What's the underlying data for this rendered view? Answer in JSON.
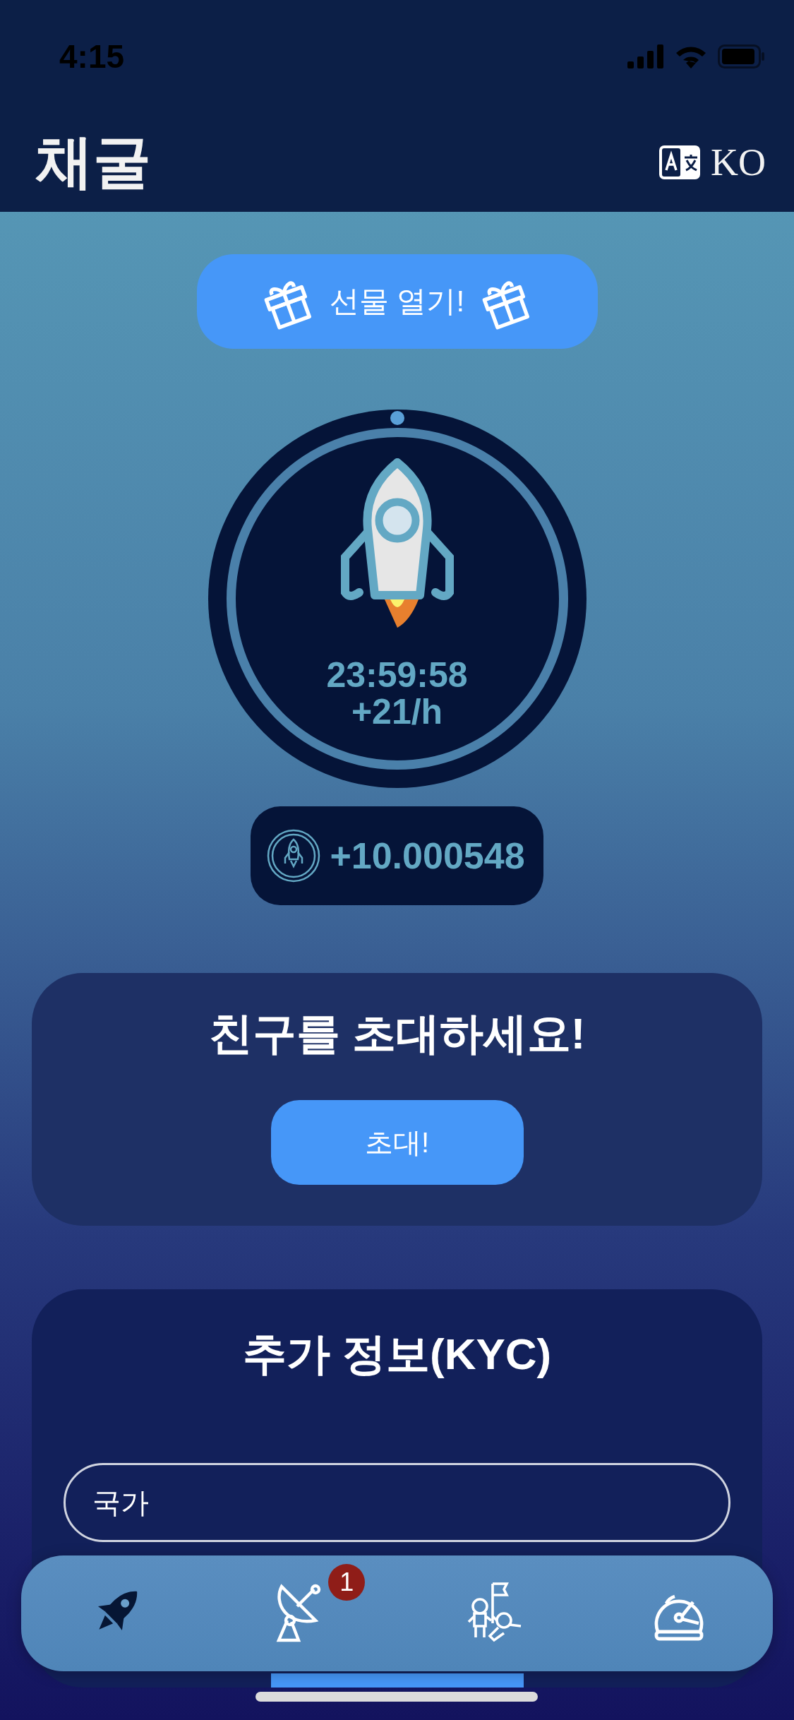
{
  "status_bar": {
    "time": "4:15"
  },
  "header": {
    "title": "채굴",
    "language": "KO"
  },
  "gift_button": {
    "label": "선물 열기!"
  },
  "miner": {
    "timer": "23:59:58",
    "rate": "+21/h"
  },
  "balance": {
    "amount": "+10.000548"
  },
  "invite_card": {
    "title": "친구를 초대하세요!",
    "button": "초대!"
  },
  "kyc_card": {
    "title": "추가 정보(KYC)",
    "fields": [
      {
        "placeholder": "국가"
      }
    ]
  },
  "tab_bar": [
    {
      "kind": "rocket",
      "selected": true
    },
    {
      "kind": "satellite",
      "selected": false,
      "badge": "1"
    },
    {
      "kind": "astronauts",
      "selected": false
    },
    {
      "kind": "helmet",
      "selected": false
    }
  ]
}
